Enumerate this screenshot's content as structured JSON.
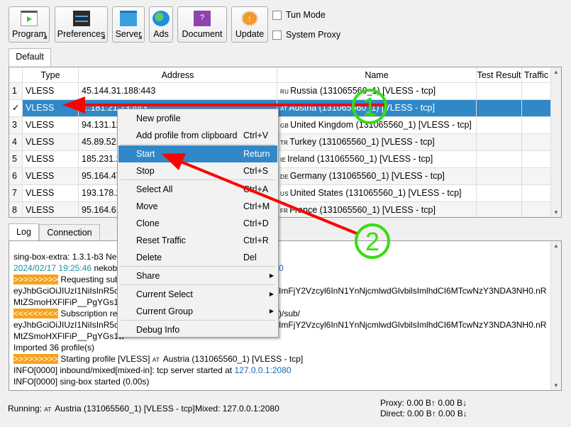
{
  "toolbar": {
    "buttons": [
      {
        "label": "Program",
        "icon": "program-icon",
        "dropdown": true
      },
      {
        "label": "Preferences",
        "icon": "preferences-icon",
        "dropdown": true
      },
      {
        "label": "Server",
        "icon": "server-folder-icon",
        "dropdown": true
      },
      {
        "label": "Ads",
        "icon": "globe-icon",
        "dropdown": false
      },
      {
        "label": "Document",
        "icon": "document-help-icon",
        "dropdown": false
      },
      {
        "label": "Update",
        "icon": "update-arrow-icon",
        "dropdown": false
      }
    ],
    "tun_mode": {
      "label": "Tun Mode",
      "checked": false
    },
    "system_proxy": {
      "label": "System Proxy",
      "checked": false
    }
  },
  "group_tabs": [
    "Default"
  ],
  "table": {
    "columns": [
      "Type",
      "Address",
      "Name",
      "Test Result",
      "Traffic"
    ],
    "rows": [
      {
        "index": "1",
        "type": "VLESS",
        "address": "45.144.31.188:443",
        "cc": "RU",
        "name": "Russia (131065560_1) [VLESS - tcp]"
      },
      {
        "index": "✓",
        "type": "VLESS",
        "address": "…181.21.73:443",
        "cc": "AT",
        "name": "Austria (131065560_1) [VLESS - tcp]",
        "selected": true
      },
      {
        "index": "3",
        "type": "VLESS",
        "address": "94.131.122",
        "cc": "GB",
        "name": "United Kingdom (131065560_1) [VLESS - tcp]"
      },
      {
        "index": "4",
        "type": "VLESS",
        "address": "45.89.52.1",
        "cc": "TR",
        "name": "Turkey (131065560_1) [VLESS - tcp]"
      },
      {
        "index": "5",
        "type": "VLESS",
        "address": "185.231.20",
        "cc": "IE",
        "name": "Ireland (131065560_1) [VLESS - tcp]"
      },
      {
        "index": "6",
        "type": "VLESS",
        "address": "95.164.47.",
        "cc": "DE",
        "name": "Germany (131065560_1) [VLESS - tcp]"
      },
      {
        "index": "7",
        "type": "VLESS",
        "address": "193.178.21",
        "cc": "US",
        "name": "United States (131065560_1) [VLESS - tcp]"
      },
      {
        "index": "8",
        "type": "VLESS",
        "address": "95.164.6.2",
        "cc": "FR",
        "name": "France (131065560_1) [VLESS - tcp]"
      }
    ]
  },
  "context_menu": [
    {
      "label": "New profile",
      "shortcut": ""
    },
    {
      "label": "Add profile from clipboard",
      "shortcut": "Ctrl+V"
    },
    {
      "label": "Start",
      "shortcut": "Return",
      "highlighted": true
    },
    {
      "label": "Stop",
      "shortcut": "Ctrl+S"
    },
    {
      "label": "Select All",
      "shortcut": "Ctrl+A"
    },
    {
      "label": "Move",
      "shortcut": "Ctrl+M"
    },
    {
      "label": "Clone",
      "shortcut": "Ctrl+D"
    },
    {
      "label": "Reset Traffic",
      "shortcut": "Ctrl+R"
    },
    {
      "label": "Delete",
      "shortcut": "Del"
    },
    {
      "label": "Share",
      "submenu": true
    },
    {
      "label": "Current Select",
      "submenu": true
    },
    {
      "label": "Current Group",
      "submenu": true
    },
    {
      "label": "Debug Info",
      "shortcut": ""
    }
  ],
  "bottom_tabs": [
    "Log",
    "Connection"
  ],
  "log": {
    "l1": "sing-box-extra: 1.3.1-b3 Nek",
    "l2_time": "2024/02/17 19:25:46",
    "l2": " nekobo",
    "l2_right": "0",
    "marker_out": ">>>>>>>>>",
    "marker_in": "<<<<<<<<<",
    "l3": " Requesting sub",
    "l4": "eyJhbGciOiJIUzI1NiIsInR5cC",
    "l4_right": "ImFjY2Vzcyl6InN1YnNjcmlwdGlvbilsImlhdCI6MTcwNzY3NDA3NH0.nR",
    "l5": "MtZSmoHXFlFiP__PgYGs1w",
    "l6": " Subscription re",
    "l6_right": ")/sub/",
    "l9": "Imported 36 profile(s)",
    "l10": " Starting profile [VLESS] ",
    "l10_cc": "AT",
    "l10_b": " Austria (131065560_1) [VLESS - tcp]",
    "l11": "INFO[0000] inbound/mixed[mixed-in]: tcp server started at ",
    "l11_addr": "127.0.0.1:2080",
    "l12": "INFO[0000] sing-box started (0.00s)"
  },
  "status": {
    "running_label": "Running: ",
    "running_cc": "AT",
    "running": " Austria (131065560_1) [VLESS - tcp]",
    "mixed": "Mixed: 127.0.0.1:2080",
    "proxy": "Proxy: 0.00 B↑ 0.00 B↓",
    "direct": "Direct: 0.00 B↑ 0.00 B↓"
  },
  "annotations": {
    "step1": "1",
    "step2": "2",
    "arrow_color": "#ff0000",
    "circle_color": "#33dd11"
  }
}
